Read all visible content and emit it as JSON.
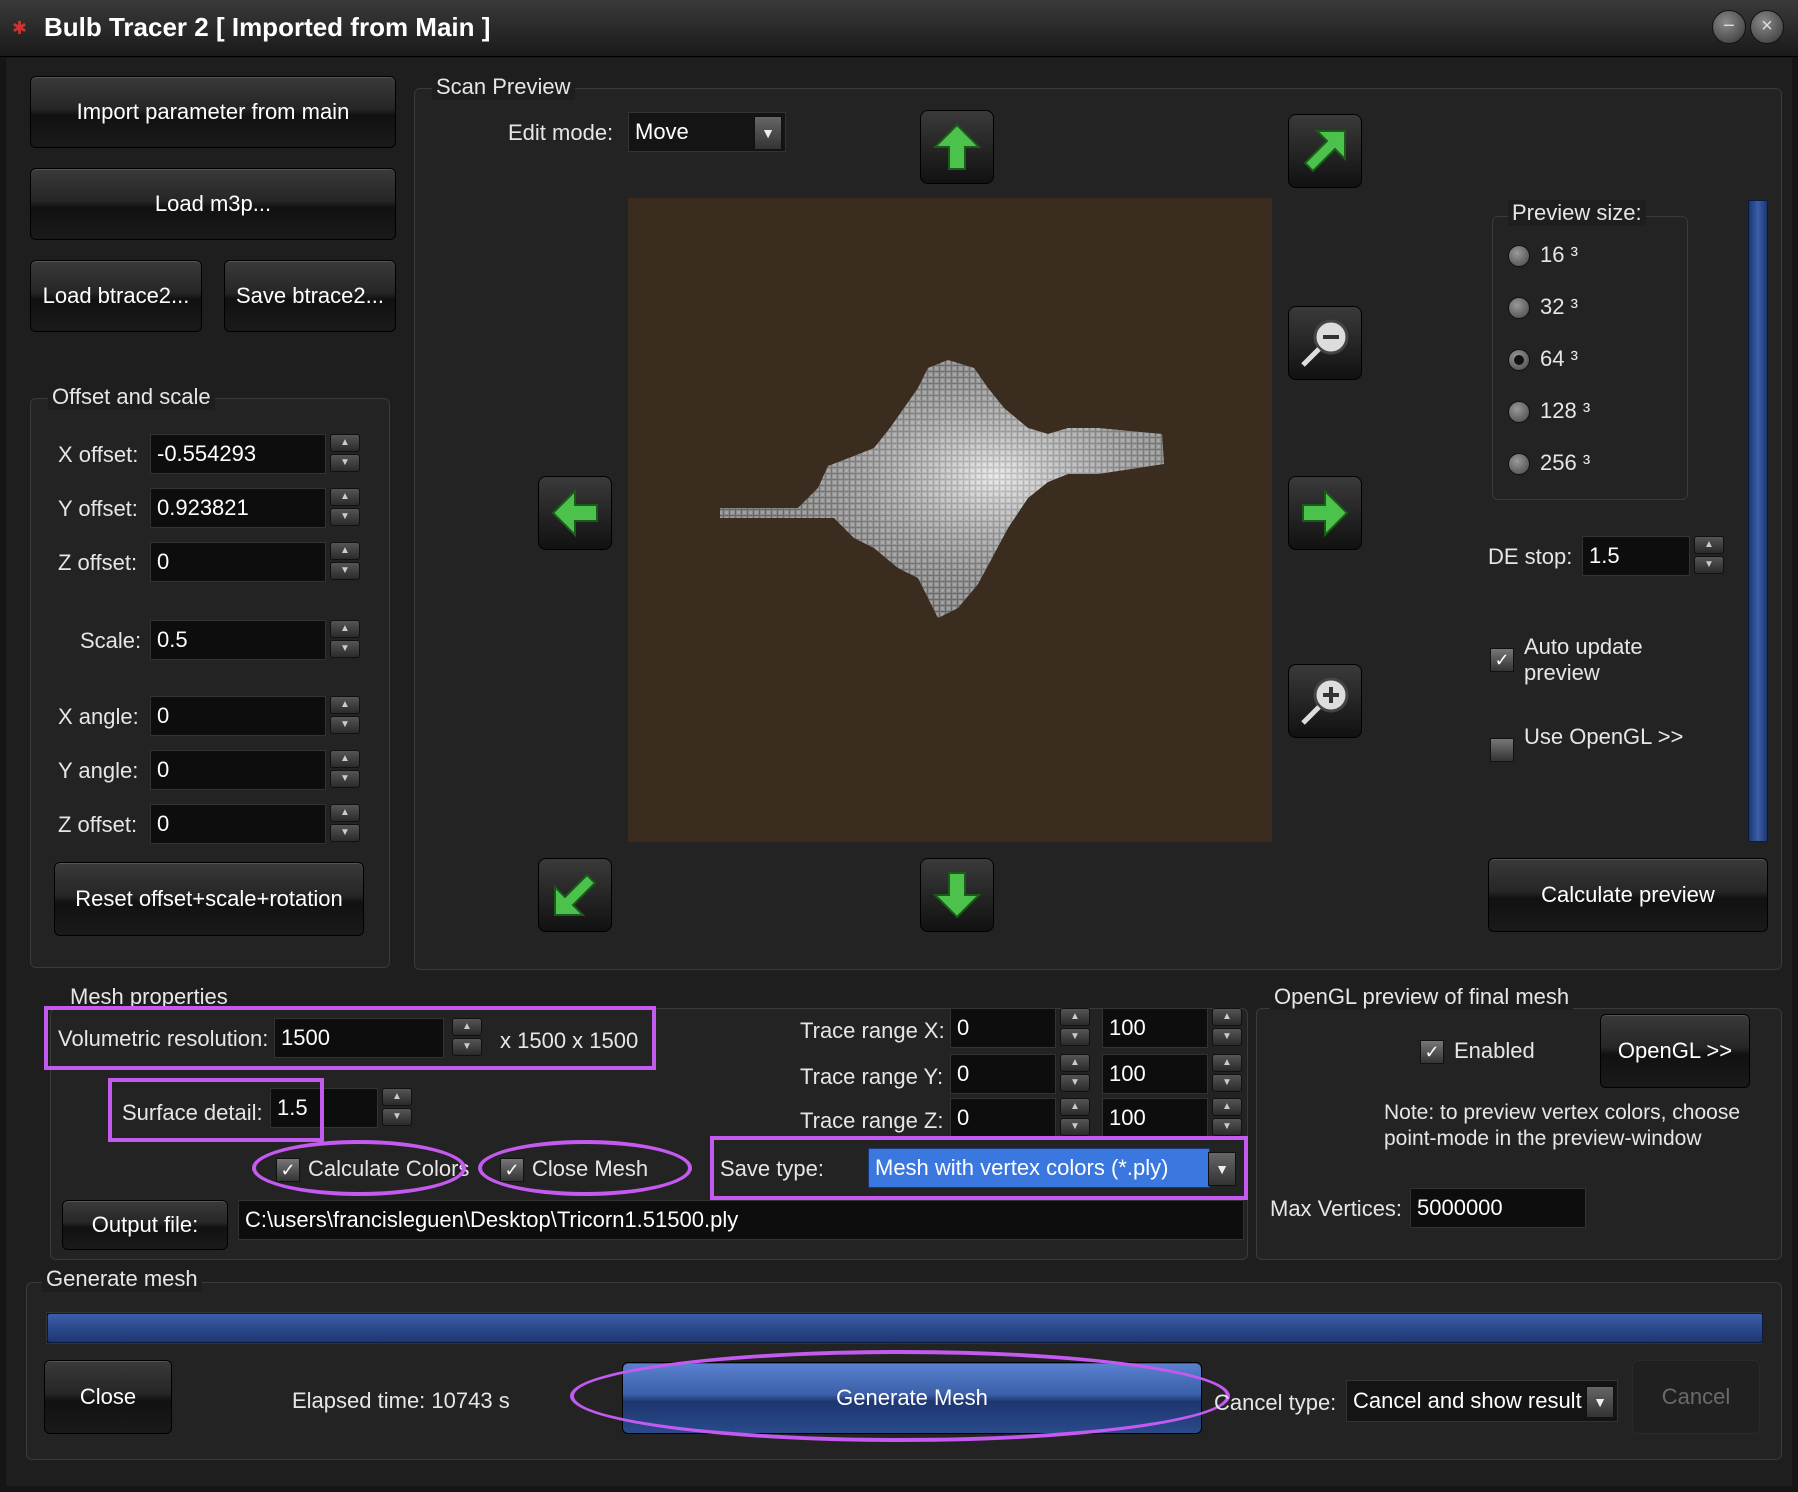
{
  "window": {
    "title": "Bulb Tracer 2 [ Imported from Main ]",
    "minimize_label": "−",
    "close_label": "×"
  },
  "left": {
    "import_btn": "Import parameter from main",
    "load_m3p_btn": "Load m3p...",
    "load_btrace_btn": "Load btrace2...",
    "save_btrace_btn": "Save btrace2...",
    "group_label": "Offset and scale",
    "x_offset_label": "X offset:",
    "x_offset_value": "-0.554293",
    "y_offset_label": "Y offset:",
    "y_offset_value": "0.923821",
    "z_offset_label": "Z offset:",
    "z_offset_value": "0",
    "scale_label": "Scale:",
    "scale_value": "0.5",
    "x_angle_label": "X angle:",
    "x_angle_value": "0",
    "y_angle_label": "Y angle:",
    "y_angle_value": "0",
    "z_angle_label": "Z offset:",
    "z_angle_value": "0",
    "reset_btn": "Reset offset+scale+rotation"
  },
  "scan": {
    "group_label": "Scan Preview",
    "edit_mode_label": "Edit mode:",
    "edit_mode_value": "Move",
    "preview_size_label": "Preview size:",
    "sizes": [
      "16 ³",
      "32 ³",
      "64 ³",
      "128 ³",
      "256 ³"
    ],
    "selected_size": "64 ³",
    "de_stop_label": "DE stop:",
    "de_stop_value": "1.5",
    "auto_update_label": "Auto update preview",
    "auto_update_checked": true,
    "use_opengl_label": "Use OpenGL >>",
    "use_opengl_checked": false,
    "calc_preview_btn": "Calculate preview",
    "preview_bg": "#3a2c1e"
  },
  "mesh": {
    "group_label": "Mesh properties",
    "vol_res_label": "Volumetric resolution:",
    "vol_res_value": "1500",
    "vol_res_suffix": "x 1500 x 1500",
    "surface_label": "Surface detail:",
    "surface_value": "1.5",
    "calc_colors_label": "Calculate Colors",
    "calc_colors_checked": true,
    "close_mesh_label": "Close Mesh",
    "close_mesh_checked": true,
    "trace_x_label": "Trace range X:",
    "trace_x_min": "0",
    "trace_x_max": "100",
    "trace_y_label": "Trace range Y:",
    "trace_y_min": "0",
    "trace_y_max": "100",
    "trace_z_label": "Trace range Z:",
    "trace_z_min": "0",
    "trace_z_max": "100",
    "save_type_label": "Save type:",
    "save_type_value": "Mesh with vertex colors (*.ply)",
    "output_btn": "Output file:",
    "output_value": "C:\\users\\francisleguen\\Desktop\\Tricorn1.51500.ply"
  },
  "opengl": {
    "group_label": "OpenGL preview of final mesh",
    "enabled_label": "Enabled",
    "enabled_checked": true,
    "opengl_btn": "OpenGL >>",
    "note": "Note: to preview vertex colors, choose point-mode in the preview-window",
    "max_vertices_label": "Max Vertices:",
    "max_vertices_value": "5000000"
  },
  "generate": {
    "group_label": "Generate mesh",
    "progress_fraction": 1.0,
    "close_btn": "Close",
    "elapsed": "Elapsed time: 10743 s",
    "generate_btn": "Generate Mesh",
    "cancel_type_label": "Cancel type:",
    "cancel_type_value": "Cancel and show result",
    "cancel_btn": "Cancel"
  },
  "colors": {
    "highlight": "#c45af0",
    "accent_blue": "#3b5fa8",
    "arrow_green": "#4cc24c"
  }
}
